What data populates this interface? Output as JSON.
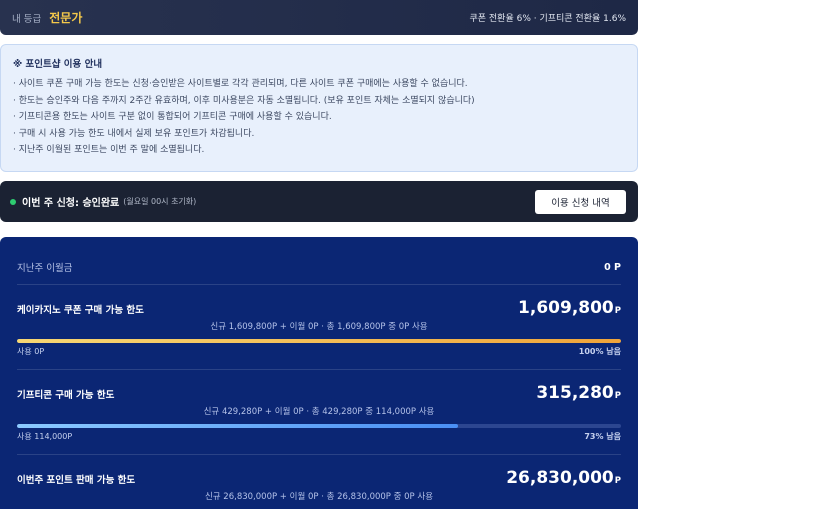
{
  "header": {
    "grade_label": "내 등급",
    "grade_value": "전문가",
    "rates": "쿠폰 전환율 6% · 기프티콘 전환율 1.6%"
  },
  "notice": {
    "title": "※ 포인트샵 이용 안내",
    "items": [
      "· 사이트 쿠폰 구매 가능 한도는 신청·승인받은 사이트별로 각각 관리되며, 다른 사이트 쿠폰 구매에는 사용할 수 없습니다.",
      "· 한도는 승인주와 다음 주까지 2주간 유효하며, 이후 미사용분은 자동 소멸됩니다. (보유 포인트 자체는 소멸되지 않습니다)",
      "· 기프티콘용 한도는 사이트 구분 없이 통합되어 기프티콘 구매에 사용할 수 있습니다.",
      "· 구매 시 사용 가능 한도 내에서 실제 보유 포인트가 차감됩니다.",
      "· 지난주 이월된 포인트는 이번 주 말에 소멸됩니다."
    ]
  },
  "status": {
    "icon": "green-dot",
    "label": "이번 주 신청: 승인완료",
    "note": "(월요일 00시 초기화)",
    "history_button": "이용 신청 내역"
  },
  "limits": {
    "carryover": {
      "label": "지난주 이월금",
      "value": "0 P"
    },
    "sections": [
      {
        "title": "케이카지노 쿠폰 구매 가능 한도",
        "amount": "1,609,800",
        "unit": "P",
        "detail": "신규 1,609,800P + 이월 0P · 총 1,609,800P 중 0P 사용",
        "used": "사용 0P",
        "remaining": "100% 남음",
        "remaining_pct": 100
      },
      {
        "title": "기프티콘 구매 가능 한도",
        "amount": "315,280",
        "unit": "P",
        "detail": "신규 429,280P + 이월 0P · 총 429,280P 중 114,000P 사용",
        "used": "사용 114,000P",
        "remaining": "73% 남음",
        "remaining_pct": 73
      },
      {
        "title": "이번주 포인트 판매 가능 한도",
        "amount": "26,830,000",
        "unit": "P",
        "detail": "신규 26,830,000P + 이월 0P · 총 26,830,000P 중 0P 사용"
      }
    ]
  },
  "colors": {
    "header_bg_start": "#28324f",
    "header_bg_end": "#1e2846",
    "grade_accent": "#f4c84a",
    "notice_bg": "#e8f0fc",
    "status_ok": "#2ecc71",
    "panel_bg": "#0b2674",
    "coupon_bar_start": "#f7d774",
    "coupon_bar_end": "#f0a43a",
    "gift_bar_start": "#8ccaff",
    "gift_bar_end": "#4a8ff4"
  }
}
